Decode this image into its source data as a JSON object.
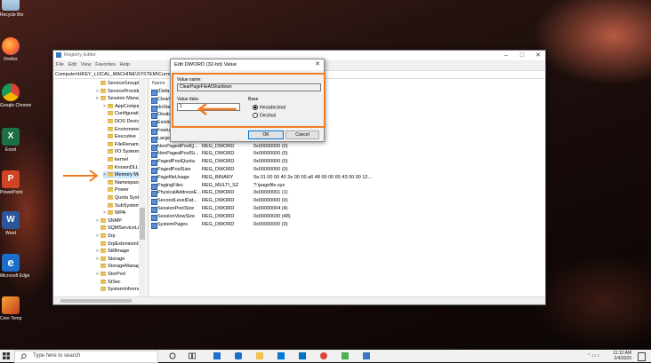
{
  "colors": {
    "accent": "#f07b23",
    "selection": "#cce8ff",
    "folder": "#e6c15c"
  },
  "desktop": {
    "icons": [
      {
        "label": "Recycle Bin",
        "icon": "recycle-bin-icon"
      },
      {
        "label": "Firefox",
        "icon": "firefox-icon"
      },
      {
        "label": "Google Chrome",
        "icon": "chrome-icon"
      },
      {
        "label": "Excel",
        "icon": "excel-icon"
      },
      {
        "label": "PowerPoint",
        "icon": "powerpoint-icon"
      },
      {
        "label": "Word",
        "icon": "word-icon"
      },
      {
        "label": "Microsoft Edge",
        "icon": "edge-icon"
      },
      {
        "label": "Core Temp",
        "icon": "core-temp-icon"
      }
    ]
  },
  "regedit": {
    "title": "Registry Editor",
    "menu": [
      "File",
      "Edit",
      "View",
      "Favorites",
      "Help"
    ],
    "address": "Computer\\HKEY_LOCAL_MACHINE\\SYSTEM\\CurrentControlSet\\Control\\Session Manager\\Memory Management",
    "tree": [
      {
        "label": "ServiceGroupO",
        "expander": "",
        "indent": 0
      },
      {
        "label": "ServiceProvide",
        "expander": ">",
        "indent": 0
      },
      {
        "label": "Session Manag",
        "expander": "v",
        "indent": 0
      },
      {
        "label": "AppCompa",
        "expander": ">",
        "indent": 1
      },
      {
        "label": "Configurati",
        "expander": "",
        "indent": 1
      },
      {
        "label": "DOS Device",
        "expander": "",
        "indent": 1
      },
      {
        "label": "Environmen",
        "expander": "",
        "indent": 1
      },
      {
        "label": "Executive",
        "expander": "",
        "indent": 1
      },
      {
        "label": "FileRenamo",
        "expander": "",
        "indent": 1
      },
      {
        "label": "I/O System",
        "expander": "",
        "indent": 1
      },
      {
        "label": "kernel",
        "expander": "",
        "indent": 1
      },
      {
        "label": "KnownDLLs",
        "expander": "",
        "indent": 1
      },
      {
        "label": "Memory Ma",
        "expander": ">",
        "indent": 1,
        "selected": true
      },
      {
        "label": "NamespaceS",
        "expander": "",
        "indent": 1
      },
      {
        "label": "Power",
        "expander": "",
        "indent": 1
      },
      {
        "label": "Quota Syste",
        "expander": "",
        "indent": 1
      },
      {
        "label": "SubSystems",
        "expander": "",
        "indent": 1
      },
      {
        "label": "WPA",
        "expander": ">",
        "indent": 1
      },
      {
        "label": "SNMP",
        "expander": ">",
        "indent": 0
      },
      {
        "label": "SQMServiceLis",
        "expander": "",
        "indent": 0
      },
      {
        "label": "Srp",
        "expander": ">",
        "indent": 0
      },
      {
        "label": "SrpExtensionC",
        "expander": "",
        "indent": 0
      },
      {
        "label": "StillImage",
        "expander": ">",
        "indent": 0
      },
      {
        "label": "Storage",
        "expander": ">",
        "indent": 0
      },
      {
        "label": "StorageManag",
        "expander": "",
        "indent": 0
      },
      {
        "label": "StorPort",
        "expander": ">",
        "indent": 0
      },
      {
        "label": "StSec",
        "expander": "",
        "indent": 0
      },
      {
        "label": "SystemInforma",
        "expander": "",
        "indent": 0
      }
    ],
    "columns": {
      "name": "Name"
    },
    "values": [
      {
        "name": "(Defa",
        "type": "",
        "data": ""
      },
      {
        "name": "ClearP",
        "type": "",
        "data": ""
      },
      {
        "name": "doSta",
        "type": "",
        "data": ""
      },
      {
        "name": "Disab",
        "type": "",
        "data": ""
      },
      {
        "name": "Existin",
        "type": "",
        "data": ""
      },
      {
        "name": "Featur",
        "type": "",
        "data": ""
      },
      {
        "name": "LargeSystemCac...",
        "type": "REG_DWORD",
        "data": "0x00000000 (0)"
      },
      {
        "name": "NonPagedPoolQ...",
        "type": "REG_DWORD",
        "data": "0x00000000 (0)"
      },
      {
        "name": "NonPagedPoolSi...",
        "type": "REG_DWORD",
        "data": "0x00000000 (0)"
      },
      {
        "name": "PagedPoolQuota",
        "type": "REG_DWORD",
        "data": "0x00000000 (0)"
      },
      {
        "name": "PagedPoolSize",
        "type": "REG_DWORD",
        "data": "0x00000000 (0)"
      },
      {
        "name": "PagefileUsage",
        "type": "REG_BINARY",
        "data": "0a 01 00 00 40 2e 00 00 a6 48 00 00 65 43 00 00 12..."
      },
      {
        "name": "PagingFiles",
        "type": "REG_MULTI_SZ",
        "data": "?:\\pagefile.sys"
      },
      {
        "name": "PhysicalAddressE...",
        "type": "REG_DWORD",
        "data": "0x00000001 (1)"
      },
      {
        "name": "SecondLevelDat...",
        "type": "REG_DWORD",
        "data": "0x00000000 (0)"
      },
      {
        "name": "SessionPoolSize",
        "type": "REG_DWORD",
        "data": "0x00000004 (4)"
      },
      {
        "name": "SessionViewSize",
        "type": "REG_DWORD",
        "data": "0x00000030 (48)"
      },
      {
        "name": "SystemPages",
        "type": "REG_DWORD",
        "data": "0x00000000 (0)"
      }
    ]
  },
  "dialog": {
    "title": "Edit DWORD (32-bit) Value",
    "value_name_label": "Value name:",
    "value_name": "ClearPageFileAtShutdown",
    "value_data_label": "Value data:",
    "value_data": "1",
    "base_label": "Base",
    "base_options": [
      "Hexadecimal",
      "Decimal"
    ],
    "base_selected": "Hexadecimal",
    "ok_label": "OK",
    "cancel_label": "Cancel"
  },
  "taskbar": {
    "search_placeholder": "Type here to search",
    "time": "11:12 AM",
    "date": "2/4/2020"
  }
}
